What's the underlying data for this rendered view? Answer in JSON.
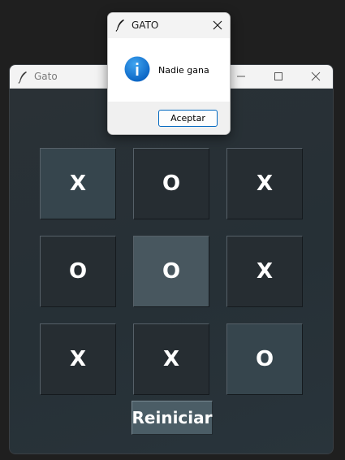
{
  "window": {
    "title": "Gato",
    "minimize_icon": "minimize-icon",
    "maximize_icon": "maximize-icon",
    "close_icon": "close-icon"
  },
  "board": {
    "cells": [
      {
        "mark": "X",
        "shade": "mid"
      },
      {
        "mark": "O",
        "shade": "dark"
      },
      {
        "mark": "X",
        "shade": "dark"
      },
      {
        "mark": "O",
        "shade": "dark"
      },
      {
        "mark": "O",
        "shade": "light"
      },
      {
        "mark": "X",
        "shade": "dark"
      },
      {
        "mark": "X",
        "shade": "dark"
      },
      {
        "mark": "X",
        "shade": "dark"
      },
      {
        "mark": "O",
        "shade": "mid"
      }
    ]
  },
  "reset_button": {
    "label": "Reiniciar"
  },
  "dialog": {
    "title": "GATO",
    "message": "Nadie gana",
    "ok_label": "Aceptar",
    "icon": "info-icon"
  },
  "colors": {
    "background": "#262d32",
    "cell_dark": "#262d32",
    "cell_mid": "#36454d",
    "cell_light": "#48575f",
    "accent": "#0067c0"
  }
}
